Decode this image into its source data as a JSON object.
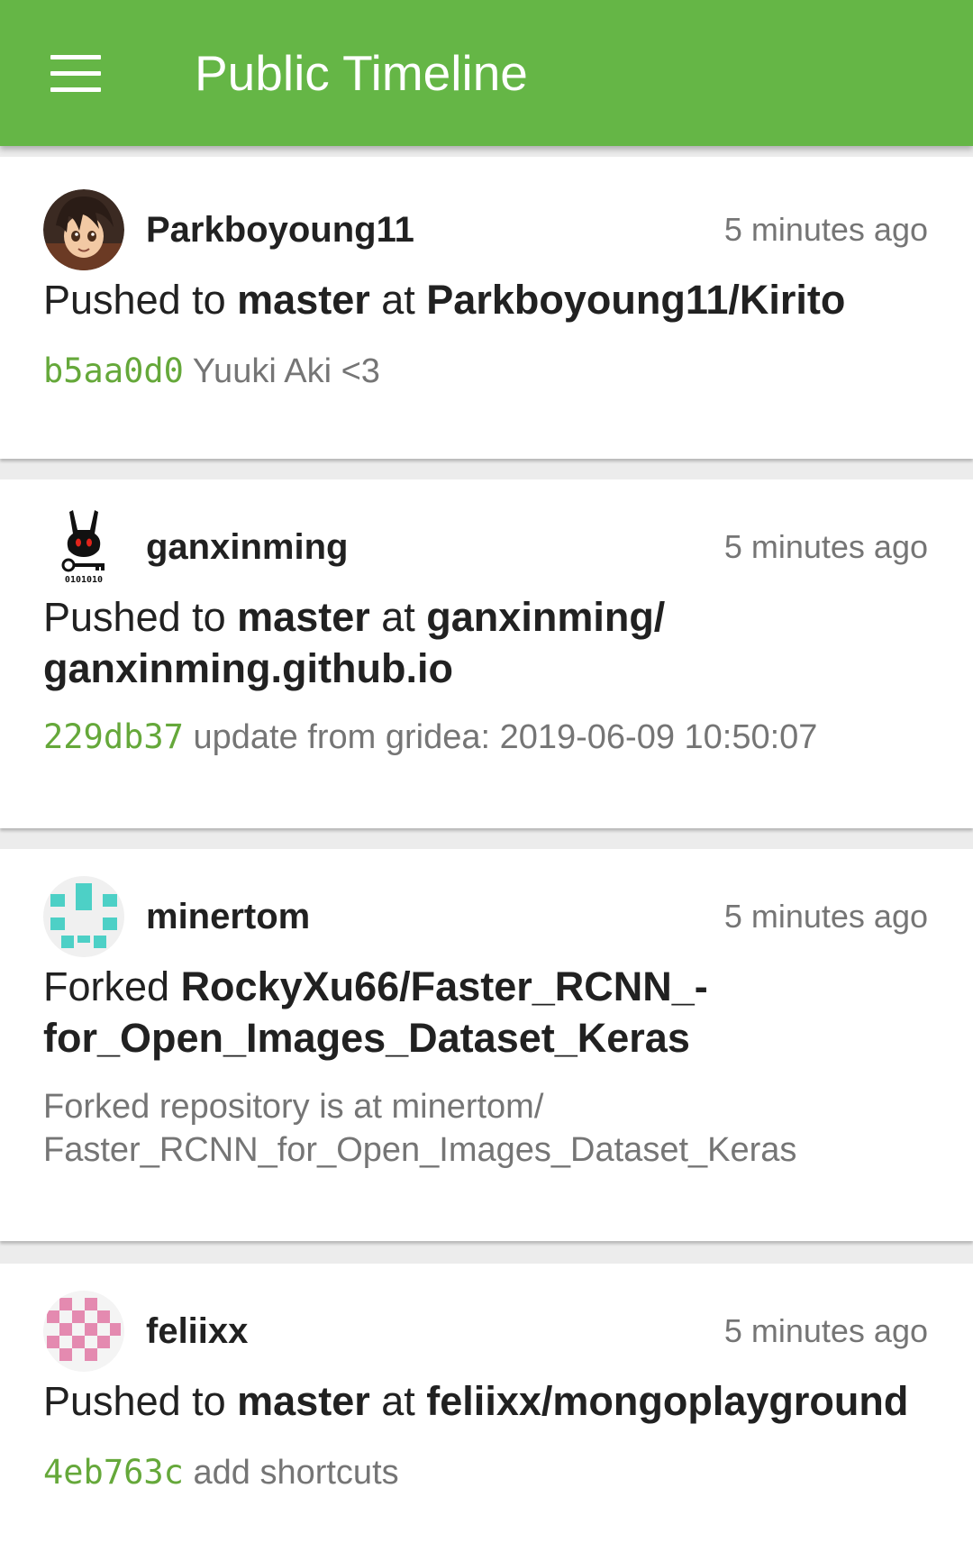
{
  "appbar": {
    "title": "Public Timeline",
    "menu_icon": "hamburger-menu-icon",
    "color": "#65b646"
  },
  "accent_sha_color": "#65a83a",
  "events": [
    {
      "user": "Parkboyoung11",
      "time": "5 minutes ago",
      "avatar": "anime-character-avatar",
      "action": "Pushed to ",
      "ref": "master",
      "at": " at ",
      "repo": "Parkboyoung11/Kirito",
      "sha": "b5aa0d0",
      "message": " Yuuki Aki <3"
    },
    {
      "user": "ganxinming",
      "time": "5 minutes ago",
      "avatar": "rabbit-key-avatar",
      "avatar_text": "0101010",
      "action": "Pushed to ",
      "ref": "master",
      "at": " at ",
      "repo": "ganxinming/ ganxinming.github.io",
      "sha": "229db37",
      "message": " update from gridea: 2019-06-09 10:50:07"
    },
    {
      "user": "minertom",
      "time": "5 minutes ago",
      "avatar": "teal-identicon-avatar",
      "action": "Forked ",
      "repo": "RockyXu66/Faster_RCNN_- for_Open_Images_Dataset_Keras",
      "detail": "Forked repository is at minertom/ Faster_RCNN_for_Open_Images_Dataset_Keras"
    },
    {
      "user": "feliixx",
      "time": "5 minutes ago",
      "avatar": "pink-identicon-avatar",
      "action": "Pushed to ",
      "ref": "master",
      "at": " at ",
      "repo": "feliixx/mongoplayground",
      "sha": "4eb763c",
      "message": " add shortcuts"
    }
  ]
}
